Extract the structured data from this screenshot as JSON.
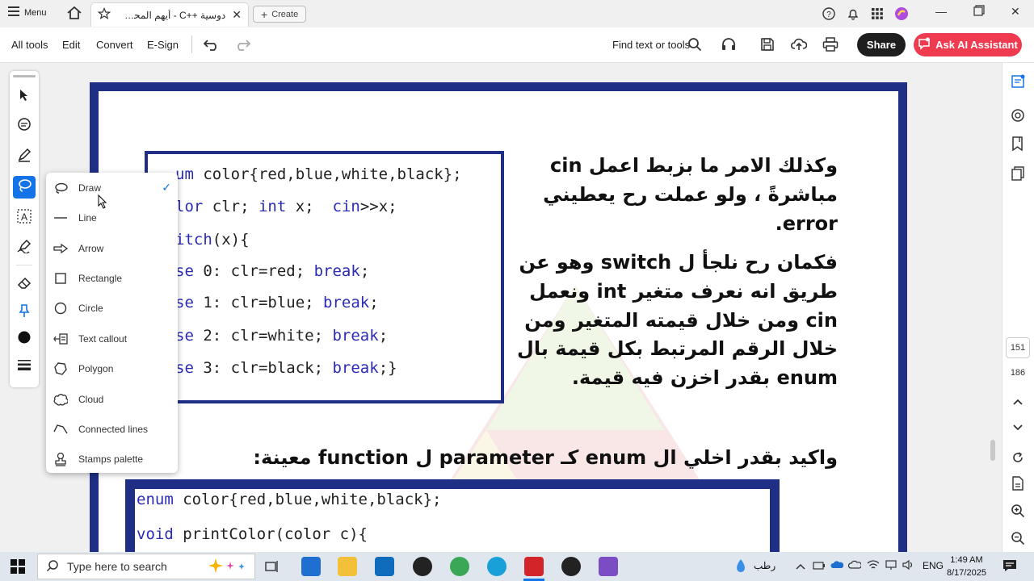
{
  "tabbar": {
    "menu_label": "Menu",
    "doc_tab_title": "دوسية ++C - أيهم المحسيري.",
    "create_label": "Create"
  },
  "toolbar": {
    "all_tools": "All tools",
    "edit": "Edit",
    "convert": "Convert",
    "esign": "E-Sign",
    "find_placeholder": "Find text or tools",
    "share": "Share",
    "ai_assistant": "Ask AI Assistant"
  },
  "draw_menu": {
    "items": [
      {
        "label": "Draw",
        "icon": "draw-lasso-icon",
        "checked": true
      },
      {
        "label": "Line",
        "icon": "line-icon"
      },
      {
        "label": "Arrow",
        "icon": "arrow-icon"
      },
      {
        "label": "Rectangle",
        "icon": "rectangle-icon"
      },
      {
        "label": "Circle",
        "icon": "circle-icon"
      },
      {
        "label": "Text callout",
        "icon": "text-callout-icon"
      },
      {
        "label": "Polygon",
        "icon": "polygon-icon"
      },
      {
        "label": "Cloud",
        "icon": "cloud-icon"
      },
      {
        "label": "Connected lines",
        "icon": "connected-lines-icon"
      },
      {
        "label": "Stamps palette",
        "icon": "stamp-icon"
      }
    ]
  },
  "document": {
    "code1": [
      {
        "pre": "um ",
        "kw": "",
        "rest": "color{red,blue,white,black};"
      },
      {
        "pre": "lor",
        "kw": "",
        "rest": " clr; ",
        "kw2": "int",
        "rest2": " x;  ",
        "kw3": "cin",
        "rest3": ">>x;"
      },
      {
        "pre": "itch",
        "kw": "",
        "rest": "(x){"
      },
      {
        "pre": "se",
        "kw": "",
        "rest": " 0: clr=red; ",
        "kw2": "break",
        "rest2": ";"
      },
      {
        "pre": "se",
        "kw": "",
        "rest": " 1: clr=blue; ",
        "kw2": "break",
        "rest2": ";"
      },
      {
        "pre": "se",
        "kw": "",
        "rest": " 2: clr=white; ",
        "kw2": "break",
        "rest2": ";"
      },
      {
        "pre": "se",
        "kw": "",
        "rest": " 3: clr=black; ",
        "kw2": "break",
        "rest2": ";}"
      }
    ],
    "arabic_para1": [
      "وكذلك الامر ما بزبط اعمل cin",
      "مباشرةً ، ولو عملت رح يعطيني",
      "error."
    ],
    "arabic_para2": [
      "فكمان رح نلجأ ل switch وهو عن",
      "طريق انه نعرف متغير int ونعمل",
      "cin ومن خلال قيمته المتغير ومن",
      "خلال الرقم المرتبط بكل قيمة بال",
      "enum بقدر اخزن فيه قيمة."
    ],
    "arabic_para3": "واكيد بقدر اخلي ال enum كـ parameter ل function معينة:",
    "code2": [
      {
        "kw": "enum",
        "rest": " color{red,blue,white,black};"
      },
      {
        "kw": "void",
        "rest": " printColor(color c){"
      }
    ]
  },
  "right_rail": {
    "current_page": "151",
    "total_pages": "186"
  },
  "taskbar": {
    "search_placeholder": "Type here to search",
    "weather": "رطب",
    "lang": "ENG",
    "time": "1:49 AM",
    "date": "8/17/2025"
  },
  "colors": {
    "accent_blue": "#1473e6",
    "page_border": "#1f2f86",
    "ai_red": "#ef3a4f",
    "keyword_blue": "#2b2bb8"
  }
}
